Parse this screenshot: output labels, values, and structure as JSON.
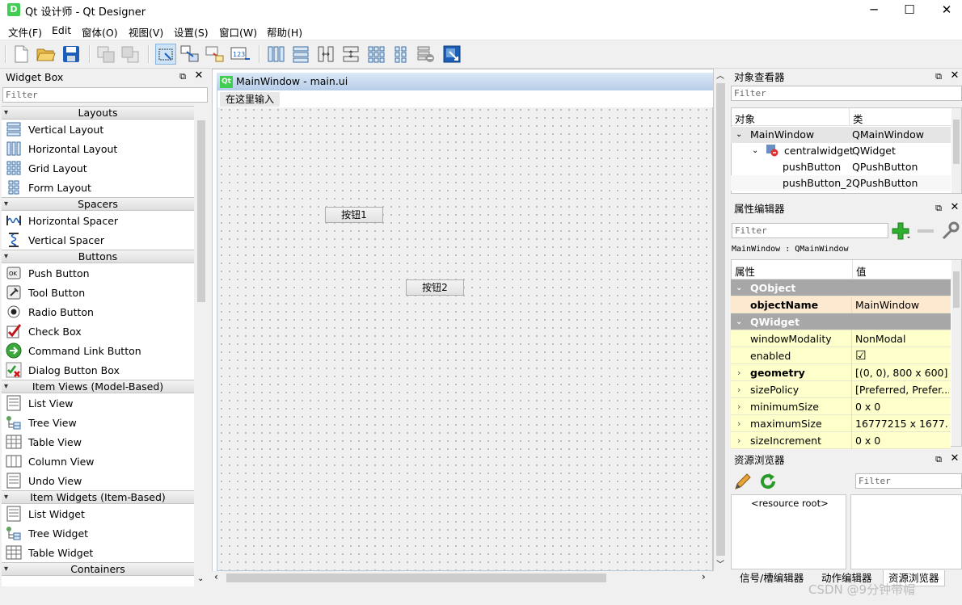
{
  "window": {
    "title": "Qt 设计师 - Qt Designer",
    "app_icon": "D",
    "controls": {
      "minimize": "─",
      "maximize": "☐",
      "close": "✕"
    }
  },
  "menubar": [
    "文件(F)",
    "Edit",
    "窗体(O)",
    "视图(V)",
    "设置(S)",
    "窗口(W)",
    "帮助(H)"
  ],
  "toolbar": [
    "new-file-icon",
    "open-folder-icon",
    "save-icon",
    "send-to-back-icon",
    "bring-to-front-icon",
    "edit-widgets-icon",
    "edit-signals-slots-icon",
    "edit-buddies-icon",
    "edit-tab-order-icon",
    "lay-out-horizontally-icon",
    "lay-out-vertically-icon",
    "lay-out-horizontal-splitter-icon",
    "lay-out-vertical-splitter-icon",
    "lay-out-grid-icon",
    "lay-out-form-icon",
    "break-layout-icon",
    "adjust-size-icon"
  ],
  "widget_box": {
    "title": "Widget Box",
    "filter_placeholder": "Filter",
    "categories": [
      {
        "name": "Layouts",
        "items": [
          "Vertical Layout",
          "Horizontal Layout",
          "Grid Layout",
          "Form Layout"
        ]
      },
      {
        "name": "Spacers",
        "items": [
          "Horizontal Spacer",
          "Vertical Spacer"
        ]
      },
      {
        "name": "Buttons",
        "items": [
          "Push Button",
          "Tool Button",
          "Radio Button",
          "Check Box",
          "Command Link Button",
          "Dialog Button Box"
        ]
      },
      {
        "name": "Item Views (Model-Based)",
        "items": [
          "List View",
          "Tree View",
          "Table View",
          "Column View",
          "Undo View"
        ]
      },
      {
        "name": "Item Widgets (Item-Based)",
        "items": [
          "List Widget",
          "Tree Widget",
          "Table Widget"
        ]
      },
      {
        "name": "Containers",
        "items": []
      }
    ]
  },
  "form": {
    "title": "MainWindow - main.ui",
    "menu_placeholder": "在这里输入",
    "buttons": [
      "按钮1",
      "按钮2"
    ]
  },
  "object_inspector": {
    "title": "对象查看器",
    "filter_placeholder": "Filter",
    "headers": [
      "对象",
      "类"
    ],
    "rows": [
      {
        "object": "MainWindow",
        "class": "QMainWindow"
      },
      {
        "object": "centralwidget",
        "class": "QWidget"
      },
      {
        "object": "pushButton",
        "class": "QPushButton"
      },
      {
        "object": "pushButton_2",
        "class": "QPushButton"
      }
    ]
  },
  "property_editor": {
    "title": "属性编辑器",
    "filter_placeholder": "Filter",
    "context": "MainWindow : QMainWindow",
    "headers": [
      "属性",
      "值"
    ],
    "rows": [
      {
        "type": "group",
        "key": "QObject"
      },
      {
        "type": "prop",
        "key": "objectName",
        "value": "MainWindow",
        "bold": true
      },
      {
        "type": "group",
        "key": "QWidget"
      },
      {
        "type": "prop",
        "key": "windowModality",
        "value": "NonModal"
      },
      {
        "type": "prop",
        "key": "enabled",
        "value": "☑"
      },
      {
        "type": "prop",
        "key": "geometry",
        "value": "[(0, 0), 800 x 600]",
        "bold": true,
        "expandable": true
      },
      {
        "type": "prop",
        "key": "sizePolicy",
        "value": "[Preferred, Prefer...",
        "expandable": true
      },
      {
        "type": "prop",
        "key": "minimumSize",
        "value": "0 x 0",
        "expandable": true
      },
      {
        "type": "prop",
        "key": "maximumSize",
        "value": "16777215 x 1677...",
        "expandable": true
      },
      {
        "type": "prop",
        "key": "sizeIncrement",
        "value": "0 x 0",
        "expandable": true
      }
    ]
  },
  "resource_browser": {
    "title": "资源浏览器",
    "filter_placeholder": "Filter",
    "root": "<resource root>"
  },
  "bottom_tabs": [
    "信号/槽编辑器",
    "动作编辑器",
    "资源浏览器"
  ],
  "watermark": "CSDN @9分钟带帽",
  "colors": {
    "accent": "#41cd52",
    "prop_yellow": "#ffffcc",
    "prop_orange": "#fde8d0",
    "group_gray": "#a7a7a7"
  }
}
